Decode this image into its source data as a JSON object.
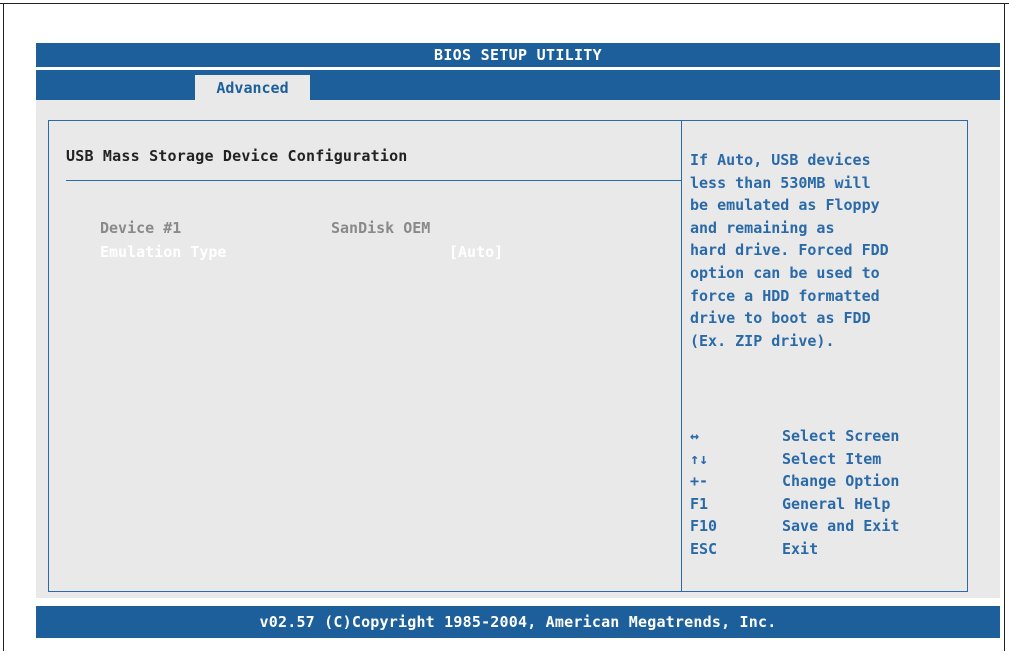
{
  "title": "BIOS SETUP UTILITY",
  "tabs": [
    {
      "label": "Advanced",
      "active": true
    }
  ],
  "section": {
    "title": "USB Mass Storage Device Configuration"
  },
  "device": {
    "label": "Device #1",
    "value": "SanDisk OEM"
  },
  "emulation": {
    "label": "Emulation Type",
    "value": "[Auto]"
  },
  "help": {
    "text": "If Auto, USB devices\nless than 530MB will\nbe emulated as Floppy\nand remaining as\nhard drive. Forced FDD\noption can be used to\nforce a HDD formatted\ndrive to boot as FDD\n(Ex. ZIP drive)."
  },
  "keys": [
    {
      "key": "↔",
      "desc": "Select Screen"
    },
    {
      "key": "↑↓",
      "desc": "Select Item"
    },
    {
      "key": "+-",
      "desc": "Change Option"
    },
    {
      "key": "F1",
      "desc": "General Help"
    },
    {
      "key": "F10",
      "desc": "Save and Exit"
    },
    {
      "key": "ESC",
      "desc": "Exit"
    }
  ],
  "footer": "v02.57 (C)Copyright 1985-2004, American Megatrends, Inc.",
  "colors": {
    "header_blue": "#1c5f9a",
    "panel_gray": "#e9e9e9",
    "text_blue": "#2a6aa8"
  }
}
